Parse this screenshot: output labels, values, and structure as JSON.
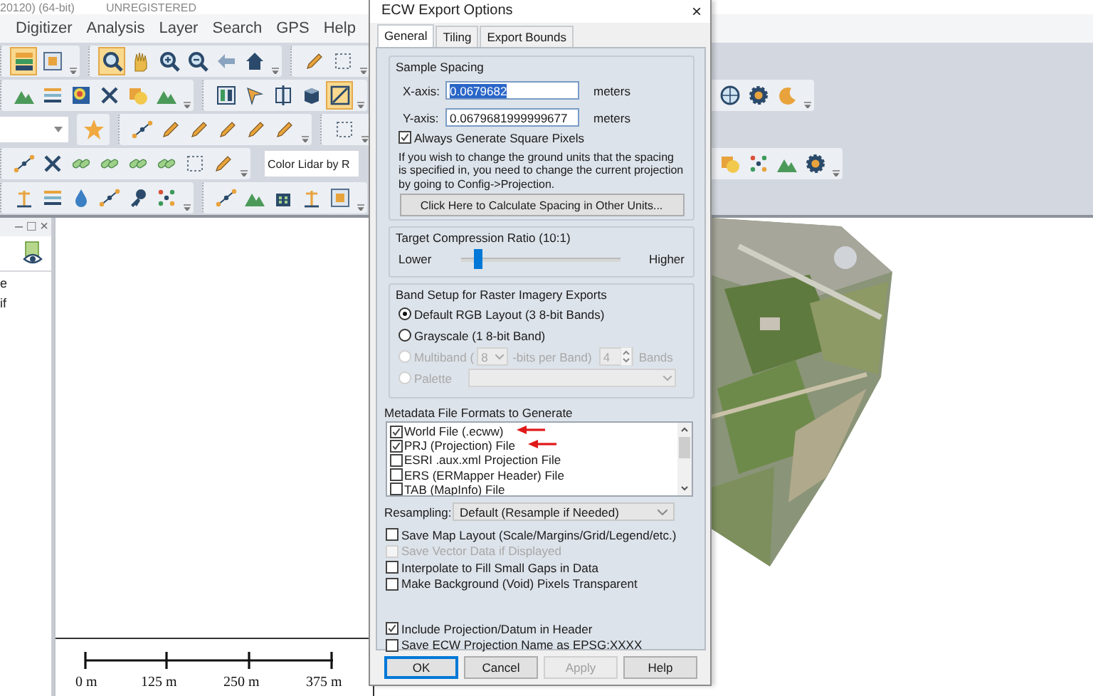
{
  "app": {
    "title": "20120) (64-bit)",
    "registration": "UNREGISTERED"
  },
  "menu": [
    "Digitizer",
    "Analysis",
    "Layer",
    "Search",
    "GPS",
    "Help"
  ],
  "toolbar": {
    "rows": [
      {
        "left": [
          {
            "kind": "group",
            "buttons": [
              {
                "kind": "layers",
                "selected": true
              },
              {
                "kind": "window",
                "selected": false
              }
            ]
          },
          {
            "kind": "group",
            "buttons": [
              {
                "kind": "magnifier",
                "selected": true
              },
              {
                "kind": "hand",
                "selected": false
              },
              {
                "kind": "zoom-in",
                "selected": false
              },
              {
                "kind": "zoom-out",
                "selected": false
              },
              {
                "kind": "arrow-left",
                "selected": false
              },
              {
                "kind": "house",
                "selected": false
              }
            ]
          },
          {
            "kind": "group",
            "buttons": [
              {
                "kind": "pencil",
                "selected": false
              },
              {
                "kind": "dotted-square",
                "selected": false
              }
            ]
          }
        ],
        "right": []
      },
      {
        "left": [
          {
            "kind": "group",
            "buttons": [
              {
                "kind": "mountains",
                "selected": false
              },
              {
                "kind": "strata",
                "selected": false
              },
              {
                "kind": "heatmap",
                "selected": false
              },
              {
                "kind": "cross",
                "selected": false
              },
              {
                "kind": "shapes",
                "selected": false
              },
              {
                "kind": "mountains",
                "selected": false
              }
            ]
          },
          {
            "kind": "group",
            "buttons": [
              {
                "kind": "panels",
                "selected": false
              },
              {
                "kind": "cursor",
                "selected": false
              },
              {
                "kind": "split",
                "selected": false
              },
              {
                "kind": "cube",
                "selected": false
              },
              {
                "kind": "diagonal",
                "selected": true
              }
            ]
          }
        ],
        "right": [
          {
            "kind": "group",
            "buttons": [
              {
                "kind": "globe",
                "selected": false
              },
              {
                "kind": "gear",
                "selected": false
              },
              {
                "kind": "crescent",
                "selected": false
              }
            ]
          }
        ]
      },
      {
        "left": [
          {
            "kind": "combo"
          },
          {
            "kind": "single",
            "buttons": [
              {
                "kind": "star",
                "selected": false
              }
            ]
          },
          {
            "kind": "group",
            "buttons": [
              {
                "kind": "dots-line",
                "selected": false
              },
              {
                "kind": "pencil",
                "selected": false
              },
              {
                "kind": "pencil",
                "selected": false
              },
              {
                "kind": "pencil",
                "selected": false
              },
              {
                "kind": "pencil",
                "selected": false
              },
              {
                "kind": "pencil",
                "selected": false
              }
            ]
          },
          {
            "kind": "group",
            "buttons": [
              {
                "kind": "dotted-square",
                "selected": false
              }
            ]
          }
        ],
        "right": []
      },
      {
        "left": [
          {
            "kind": "group",
            "buttons": [
              {
                "kind": "dots-line",
                "selected": false
              },
              {
                "kind": "cross",
                "selected": false
              },
              {
                "kind": "chain",
                "selected": false
              },
              {
                "kind": "chain",
                "selected": false
              },
              {
                "kind": "chain",
                "selected": false
              },
              {
                "kind": "chain",
                "selected": false
              },
              {
                "kind": "dotted-square",
                "selected": false
              },
              {
                "kind": "pencil",
                "selected": false
              }
            ]
          },
          {
            "kind": "combo",
            "text": "Color Lidar by R"
          }
        ],
        "right": [
          {
            "kind": "group",
            "buttons": [
              {
                "kind": "shapes",
                "selected": false
              },
              {
                "kind": "grid-dots",
                "selected": false
              },
              {
                "kind": "mountains",
                "selected": false
              },
              {
                "kind": "gear",
                "selected": false
              }
            ]
          }
        ]
      },
      {
        "left": [
          {
            "kind": "group",
            "buttons": [
              {
                "kind": "pin",
                "selected": false
              },
              {
                "kind": "strata",
                "selected": false
              },
              {
                "kind": "drop",
                "selected": false
              },
              {
                "kind": "dots-line",
                "selected": false
              },
              {
                "kind": "key",
                "selected": false
              },
              {
                "kind": "grid-dots",
                "selected": false
              }
            ]
          },
          {
            "kind": "group",
            "buttons": [
              {
                "kind": "dots-line",
                "selected": false
              },
              {
                "kind": "mountains",
                "selected": false
              },
              {
                "kind": "building",
                "selected": false
              },
              {
                "kind": "pin",
                "selected": false
              },
              {
                "kind": "window",
                "selected": false
              }
            ]
          }
        ],
        "right": []
      }
    ]
  },
  "layers_panel": {
    "controls": [
      "–",
      "□",
      "×"
    ],
    "items": [
      "e",
      "if"
    ]
  },
  "scale_bar": {
    "labels": [
      "0 m",
      "125 m",
      "250 m",
      "375 m"
    ]
  },
  "dialog": {
    "title": "ECW Export Options",
    "close": "×",
    "tabs": [
      {
        "label": "General",
        "selected": true
      },
      {
        "label": "Tiling",
        "selected": false
      },
      {
        "label": "Export Bounds",
        "selected": false
      }
    ],
    "sample_spacing": {
      "title": "Sample Spacing",
      "fields": [
        {
          "label": "X-axis:",
          "value": "0.0679682",
          "text_selected": true,
          "unit": "meters"
        },
        {
          "label": "Y-axis:",
          "value": "0.0679681999999677",
          "text_selected": false,
          "unit": "meters"
        }
      ],
      "square_pixels": {
        "label": "Always Generate Square Pixels",
        "checked": true
      },
      "note": "If you wish to change the ground units that the spacing is specified in, you need to change the current projection by going to Config->Projection.",
      "button": "Click Here to Calculate Spacing in Other Units..."
    },
    "compression": {
      "title": "Target Compression Ratio (10:1)",
      "low": "Lower",
      "high": "Higher",
      "level": 0.11
    },
    "band_setup": {
      "title": "Band Setup for Raster Imagery Exports",
      "options": [
        {
          "kind": "plain",
          "label": "Default RGB Layout (3 8-bit Bands)",
          "selected": true,
          "disabled": false
        },
        {
          "kind": "plain",
          "label": "Grayscale (1 8-bit Band)",
          "selected": false,
          "disabled": false
        },
        {
          "kind": "multiband",
          "label": "Multiband (",
          "bits": "8",
          "bits_label": "-bits per Band)",
          "bands": "4",
          "bands_label": "Bands",
          "selected": false,
          "disabled": true
        },
        {
          "kind": "palette",
          "label": "Palette",
          "selected": false,
          "disabled": true
        }
      ]
    },
    "metadata": {
      "title": "Metadata File Formats to Generate",
      "items": [
        {
          "label": "World File (.ecww)",
          "checked": true
        },
        {
          "label": "PRJ (Projection) File",
          "checked": true
        },
        {
          "label": "ESRI .aux.xml Projection File",
          "checked": false
        },
        {
          "label": "ERS (ERMapper Header) File",
          "checked": false
        },
        {
          "label": "TAB (MapInfo) File",
          "checked": false
        }
      ]
    },
    "resampling": {
      "label": "Resampling:",
      "value": "Default (Resample if Needed)"
    },
    "options": [
      {
        "label": "Save Map Layout (Scale/Margins/Grid/Legend/etc.)",
        "checked": false,
        "disabled": false
      },
      {
        "label": "Save Vector Data if Displayed",
        "checked": false,
        "disabled": true
      },
      {
        "label": "Interpolate to Fill Small Gaps in Data",
        "checked": false,
        "disabled": false
      },
      {
        "label": "Make Background (Void) Pixels Transparent",
        "checked": false,
        "disabled": false
      }
    ],
    "header_options": [
      {
        "label": "Include Projection/Datum in Header",
        "checked": true,
        "disabled": false
      },
      {
        "label": "Save ECW Projection Name as EPSG:XXXX",
        "checked": false,
        "disabled": false
      }
    ],
    "buttons": [
      {
        "label": "OK",
        "kind": "default",
        "disabled": false
      },
      {
        "label": "Cancel",
        "kind": "normal",
        "disabled": false
      },
      {
        "label": "Apply",
        "kind": "normal",
        "disabled": true
      },
      {
        "label": "Help",
        "kind": "normal",
        "disabled": false
      }
    ]
  }
}
